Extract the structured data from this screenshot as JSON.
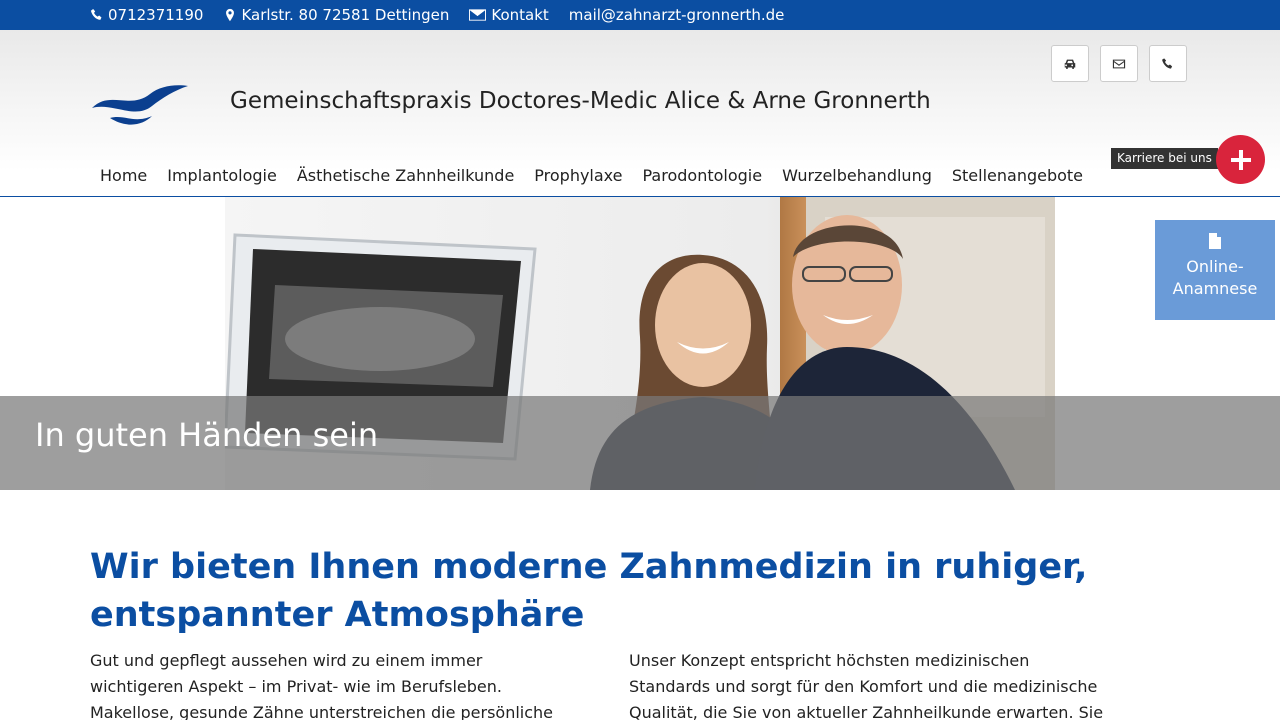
{
  "topbar": {
    "phone": "0712371190",
    "address": "Karlstr. 80 72581 Dettingen",
    "contact": "Kontakt",
    "email": "mail@zahnarzt-gronnerth.de"
  },
  "header": {
    "title": "Gemeinschaftspraxis Doctores-Medic Alice & Arne Gronnerth"
  },
  "nav": [
    {
      "label": "Home"
    },
    {
      "label": "Implantologie"
    },
    {
      "label": "Ästhetische Zahnheilkunde"
    },
    {
      "label": "Prophylaxe"
    },
    {
      "label": "Parodontologie"
    },
    {
      "label": "Wurzelbehandlung"
    },
    {
      "label": "Stellenangebote"
    }
  ],
  "career": {
    "label": "Karriere bei uns"
  },
  "anamnese": {
    "line1": "Online-",
    "line2": "Anamnese"
  },
  "hero": {
    "caption": "In guten Händen sein"
  },
  "content": {
    "headline": "Wir bieten Ihnen moderne Zahnmedizin in ruhiger, entspannter Atmosphäre",
    "left": "Gut und gepflegt aussehen wird zu einem immer wichtigeren Aspekt – im Privat- wie im Berufsleben. Makellose, gesunde Zähne unterstreichen die persönliche Ausstrahlung. Mit ihnen",
    "right": "Unser Konzept entspricht höchsten medizinischen Standards und sorgt für den Komfort und die medizinische Qualität, die Sie von aktueller Zahnheilkunde erwarten. Sie werden von einem"
  },
  "colors": {
    "brand_blue": "#0b4ea2",
    "career_red": "#d9243c",
    "anamnese_blue": "#6a9bd8"
  }
}
